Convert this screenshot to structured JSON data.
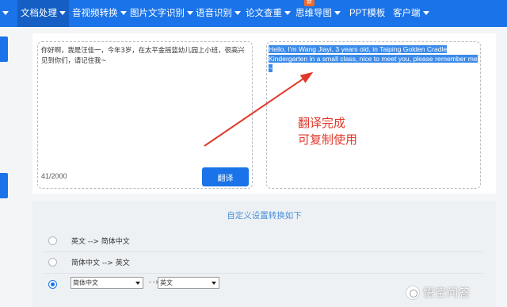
{
  "nav": {
    "items": [
      {
        "label": "▾",
        "dropdown": false
      },
      {
        "label": "文档处理",
        "dropdown": true
      },
      {
        "label": "音视频转换",
        "dropdown": true
      },
      {
        "label": "图片文字识别",
        "dropdown": true
      },
      {
        "label": "语音识别",
        "dropdown": true
      },
      {
        "label": "论文查重",
        "dropdown": true
      },
      {
        "label": "思维导图",
        "dropdown": true
      },
      {
        "label": "PPT模板",
        "dropdown": false
      },
      {
        "label": "客户端",
        "dropdown": true
      }
    ],
    "new_badge": "新"
  },
  "source": {
    "text": "你好啊，我是汪佳一，今年3岁，在太平金摇篮幼儿园上小班，很高兴见到你们，请记住我~",
    "counter": "41/2000",
    "translate_label": "翻译"
  },
  "output": {
    "text": "Hello, I'm Wang Jiayi, 3 years old, in Taiping Golden Cradle Kindergarten in a small class, nice to meet you, please remember me ~"
  },
  "annotation": {
    "line1": "翻译完成",
    "line2": "可复制使用"
  },
  "settings": {
    "title": "自定义设置转换如下",
    "options": [
      {
        "label": "英文 --> 简体中文",
        "checked": false
      },
      {
        "label": "简体中文 --> 英文",
        "checked": false
      },
      {
        "label": "",
        "checked": true
      }
    ],
    "from_select": "简体中文",
    "arrow": "-->",
    "to_select": "英文"
  },
  "watermark": "悟空问答",
  "colors": {
    "nav": "#1a73e8",
    "accent": "#1a73e8",
    "annotation": "#e0392b",
    "badge": "#f06a2c"
  }
}
